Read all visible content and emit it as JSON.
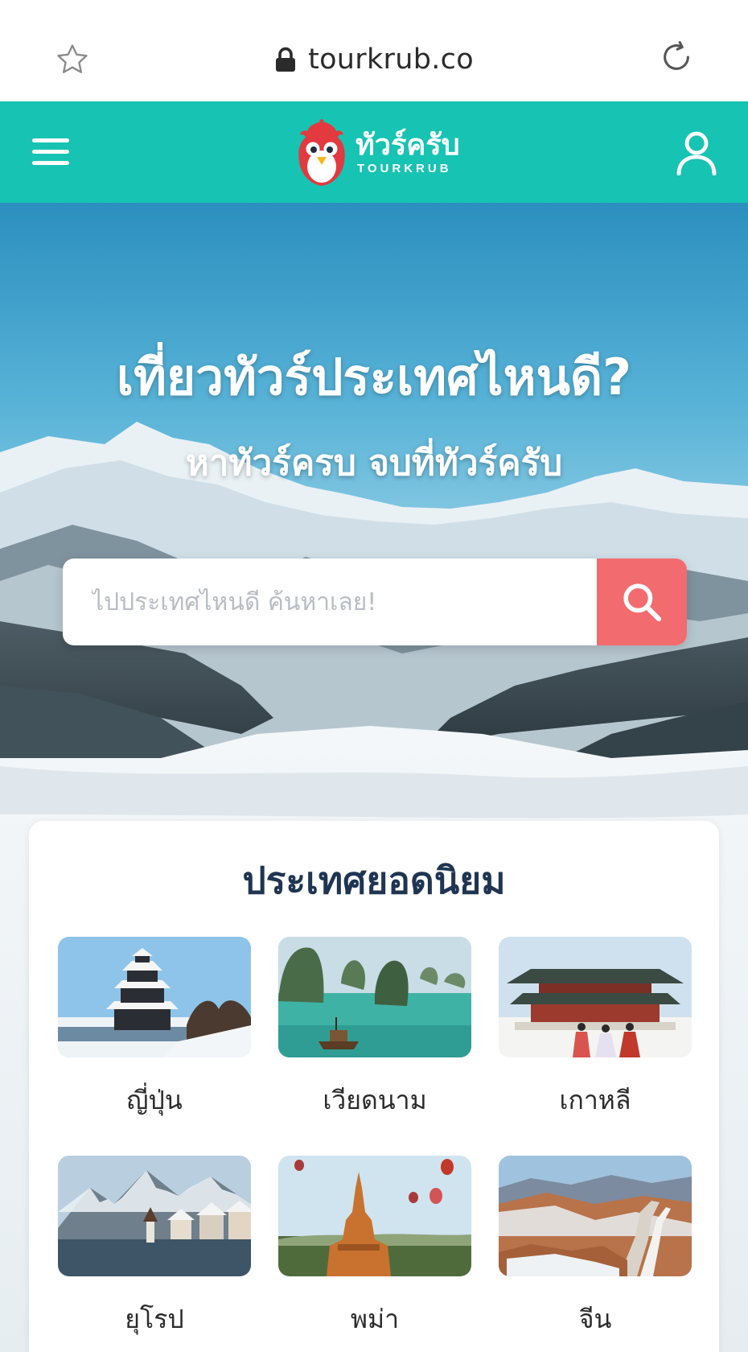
{
  "browser": {
    "url": "tourkrub.co"
  },
  "header": {
    "logo_thai": "ทัวร์ครับ",
    "logo_en": "TOURKRUB",
    "brand_color": "#17c3b2"
  },
  "hero": {
    "title": "เที่ยวทัวร์ประเทศไหนดี?",
    "subtitle": "หาทัวร์ครบ จบที่ทัวร์ครับ"
  },
  "search": {
    "placeholder": "ไปประเทศไหนดี ค้นหาเลย!",
    "value": "",
    "button_color": "#f26b6f"
  },
  "popular": {
    "title": "ประเทศยอดนิยม",
    "countries": [
      {
        "label": "ญี่ปุ่น",
        "icon": "japan-castle-image"
      },
      {
        "label": "เวียดนาม",
        "icon": "vietnam-halong-bay-image"
      },
      {
        "label": "เกาหลี",
        "icon": "korea-palace-image"
      },
      {
        "label": "ยุโรป",
        "icon": "europe-hallstatt-image"
      },
      {
        "label": "พม่า",
        "icon": "myanmar-bagan-image"
      },
      {
        "label": "จีน",
        "icon": "china-great-wall-image"
      }
    ]
  }
}
